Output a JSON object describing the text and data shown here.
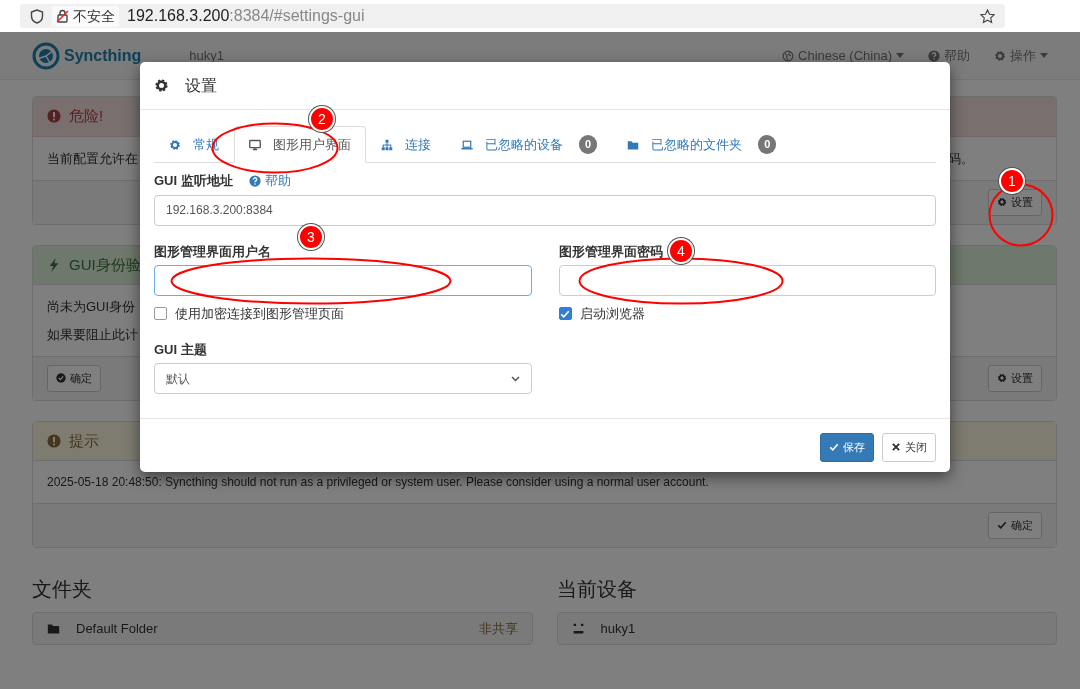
{
  "browser": {
    "security_label": "不安全",
    "url_host": "192.168.3.200",
    "url_rest": ":8384/#settings-gui"
  },
  "navbar": {
    "brand": "Syncthing",
    "device": "huky1",
    "menus": [
      {
        "label": "Chinese (China)",
        "dropdown": true
      },
      {
        "label": "帮助",
        "dropdown": false
      },
      {
        "label": "操作",
        "dropdown": true
      }
    ]
  },
  "panels": [
    {
      "kind": "danger",
      "title": "危险!",
      "lines": [
        {
          "text": "当前配置允许在",
          "right": "码。"
        }
      ],
      "buttons": [
        {
          "label": "设置"
        }
      ]
    },
    {
      "kind": "success",
      "title": "GUI身份验",
      "lines": [
        {
          "text": "尚未为GUI身份"
        },
        {
          "text": "如果要阻止此计"
        }
      ],
      "buttons": [
        {
          "label": "确定"
        },
        {
          "label": "设置"
        }
      ]
    },
    {
      "kind": "warning",
      "title": "提示",
      "lines": [
        {
          "text": "2025-05-18 20:48:50: Syncthing should not run as a privileged or system user. Please consider using a normal user account."
        }
      ],
      "buttons": [
        {
          "label": "确定"
        }
      ]
    }
  ],
  "folders": {
    "title": "文件夹",
    "items": [
      {
        "name": "Default Folder",
        "status": "非共享"
      }
    ]
  },
  "devices": {
    "title": "当前设备",
    "items": [
      {
        "name": "huky1"
      }
    ]
  },
  "modal": {
    "title": "设置",
    "tabs": [
      {
        "label": "常规",
        "selected": false
      },
      {
        "label": "图形用户界面",
        "selected": true
      },
      {
        "label": "连接",
        "selected": false
      },
      {
        "label": "已忽略的设备",
        "badge": "0",
        "selected": false
      },
      {
        "label": "已忽略的文件夹",
        "badge": "0",
        "selected": false
      }
    ],
    "address": {
      "label": "GUI 监听地址",
      "help": "帮助",
      "value": "192.168.3.200:8384"
    },
    "username": {
      "label": "图形管理界面用户名",
      "focused": true
    },
    "password": {
      "label": "图形管理界面密码",
      "focused": false
    },
    "checkboxes": [
      {
        "label": "使用加密连接到图形管理页面",
        "checked": false
      },
      {
        "label": "启动浏览器",
        "checked": true
      }
    ],
    "theme": {
      "label": "GUI 主题",
      "value": "默认"
    },
    "buttons": [
      {
        "label": "保存",
        "kind": "primary"
      },
      {
        "label": "关闭",
        "kind": "default"
      }
    ]
  },
  "annotations": [
    {
      "number": "1"
    },
    {
      "number": "2"
    },
    {
      "number": "3"
    },
    {
      "number": "4"
    }
  ]
}
